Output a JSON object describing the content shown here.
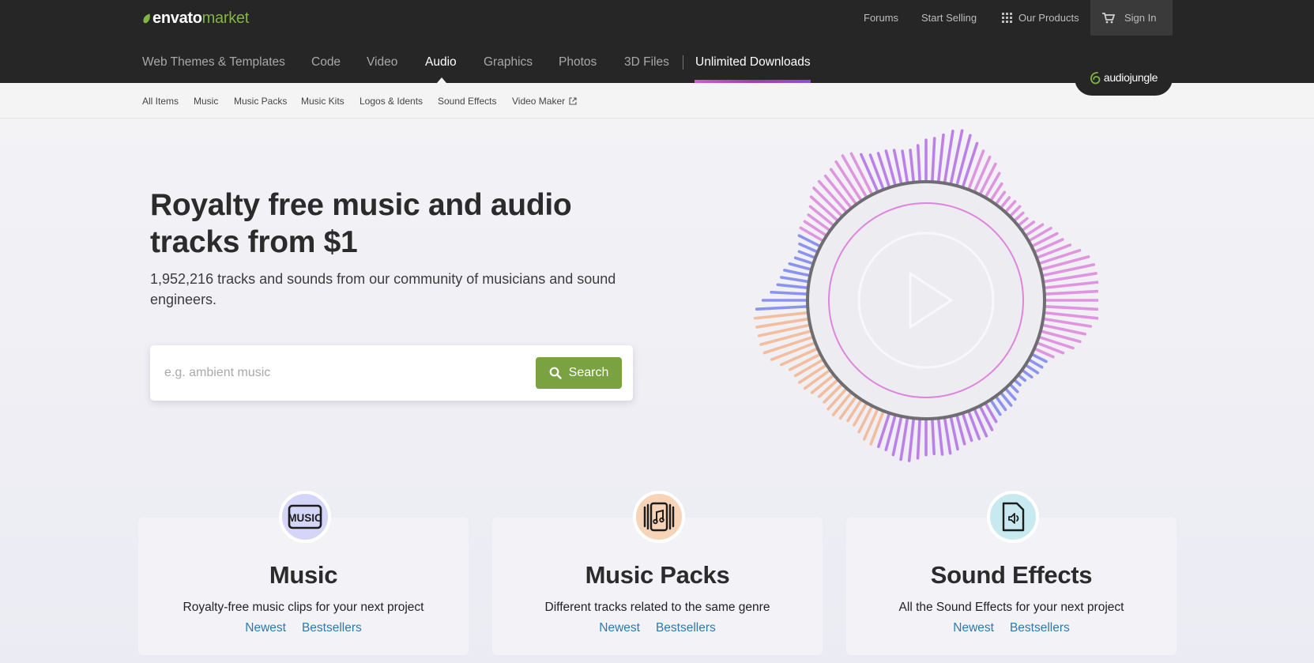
{
  "header": {
    "logo": {
      "brand": "envato",
      "suffix": "market"
    },
    "utility": {
      "forums": "Forums",
      "start_selling": "Start Selling",
      "our_products": "Our Products",
      "sign_in": "Sign In"
    },
    "categories": [
      {
        "label": "Web Themes & Templates",
        "active": false
      },
      {
        "label": "Code",
        "active": false
      },
      {
        "label": "Video",
        "active": false
      },
      {
        "label": "Audio",
        "active": true
      },
      {
        "label": "Graphics",
        "active": false
      },
      {
        "label": "Photos",
        "active": false
      },
      {
        "label": "3D Files",
        "active": false
      },
      {
        "label": "Unlimited Downloads",
        "active": false
      }
    ],
    "site_badge": "audiojungle"
  },
  "subnav": {
    "items": [
      "All Items",
      "Music",
      "Music Packs",
      "Music Kits",
      "Logos & Idents",
      "Sound Effects",
      "Video Maker"
    ]
  },
  "hero": {
    "headline": "Royalty free music and audio tracks from $1",
    "subheadline": "1,952,216 tracks and sounds from our community of musicians and sound engineers.",
    "search": {
      "placeholder": "e.g. ambient music",
      "value": "",
      "button_label": "Search"
    }
  },
  "cards": [
    {
      "title": "Music",
      "icon": "music-text-icon",
      "description": "Royalty-free music clips for your next project",
      "links": [
        "Newest",
        "Bestsellers"
      ],
      "icon_bg": "#d5d6f7"
    },
    {
      "title": "Music Packs",
      "icon": "music-pack-icon",
      "description": "Different tracks related to the same genre",
      "links": [
        "Newest",
        "Bestsellers"
      ],
      "icon_bg": "#f7d3b8"
    },
    {
      "title": "Sound Effects",
      "icon": "sound-file-icon",
      "description": "All the Sound Effects for your next project",
      "links": [
        "Newest",
        "Bestsellers"
      ],
      "icon_bg": "#c9e9f0"
    }
  ],
  "colors": {
    "header_bg": "#262626",
    "accent_green": "#7aa240",
    "logo_green": "#82b541",
    "link_blue": "#2f78ad",
    "wave_purple": "#b36ee6",
    "wave_pink": "#de85de",
    "wave_blue": "#7a83f0",
    "wave_peach": "#f4b58f"
  }
}
